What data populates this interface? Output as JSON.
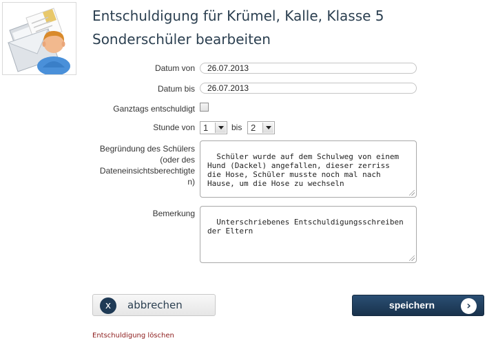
{
  "page": {
    "title": "Entschuldigung für Krümel, Kalle, Klasse 5 Sonderschüler bearbeiten",
    "icon": "envelope-person-icon"
  },
  "form": {
    "date_from_label": "Datum von",
    "date_from_value": "26.07.2013",
    "date_to_label": "Datum bis",
    "date_to_value": "26.07.2013",
    "all_day_label": "Ganztags entschuldigt",
    "all_day_checked": false,
    "period_from_label": "Stunde von",
    "period_from_value": "1",
    "period_to_label": "bis",
    "period_to_value": "2",
    "reason_label_line1": "Begründung des Schülers",
    "reason_label_line2": "(oder des",
    "reason_label_line3": "Dateneinsichtsberechtigte",
    "reason_label_line4": "n)",
    "reason_value": "Schüler wurde auf dem Schulweg von einem\nHund (Dackel) angefallen, dieser zerriss\ndie Hose, Schüler musste noch mal nach\nHause, um die Hose zu wechseln",
    "remark_label": "Bemerkung",
    "remark_value": "Unterschriebenes Entschuldigungsschreiben\nder Eltern"
  },
  "actions": {
    "cancel_label": "abbrechen",
    "cancel_icon_glyph": "x",
    "save_label": "speichern",
    "save_icon_glyph": "›",
    "delete_link": "Entschuldigung löschen"
  },
  "colors": {
    "title": "#2b3f50",
    "primary_button": "#1f3a55",
    "delete_link": "#8c1b1b"
  }
}
